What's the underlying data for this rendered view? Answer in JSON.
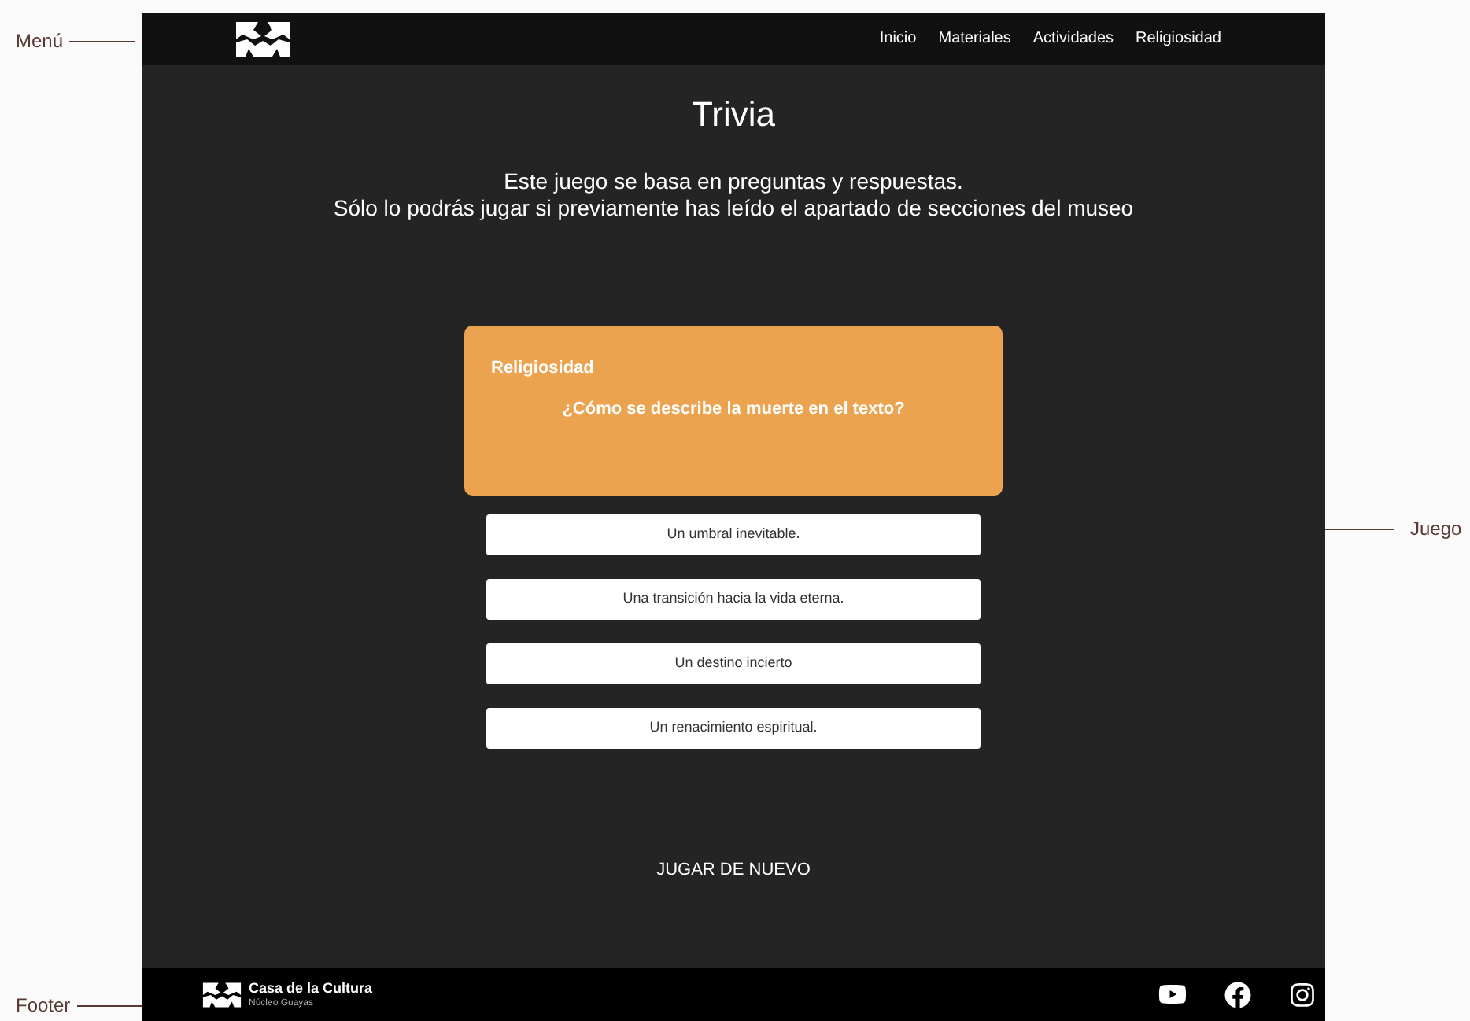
{
  "annotations": [
    {
      "label": "Menú",
      "kind": "left"
    },
    {
      "label": "Juego",
      "kind": "right"
    },
    {
      "label": "Footer",
      "kind": "left"
    }
  ],
  "nav": {
    "items": [
      "Inicio",
      "Materiales",
      "Actividades",
      "Religiosidad"
    ]
  },
  "title": "Trivia",
  "intro": [
    "Este juego se basa en preguntas y respuestas.",
    "Sólo lo podrás jugar si previamente has leído el apartado de secciones del museo"
  ],
  "question_card": {
    "category": "Religiosidad",
    "question": "¿Cómo se describe la muerte en el texto?"
  },
  "answers": [
    "Un umbral inevitable.",
    "Una transición hacia la vida eterna.",
    "Un destino incierto",
    "Un renacimiento espiritual."
  ],
  "replay_button": "JUGAR DE NUEVO",
  "footer": {
    "brand": "Casa de la Cultura",
    "subtitle": "Núcleo Guayas"
  }
}
